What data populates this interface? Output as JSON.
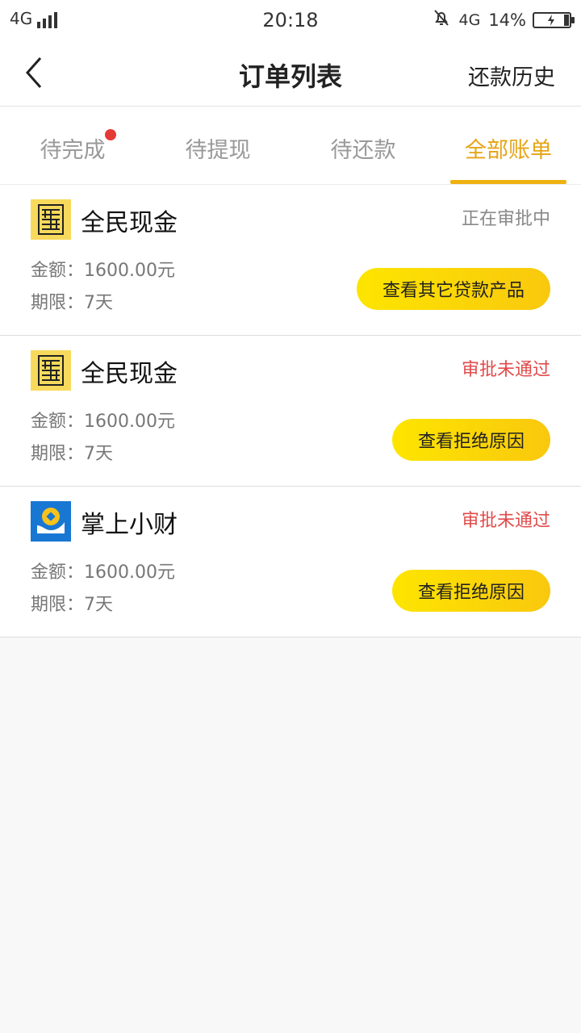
{
  "status_bar": {
    "network_left": "4G",
    "time": "20:18",
    "network_right": "4G",
    "battery_percent": "14%",
    "icons": [
      "signal-icon",
      "mute-icon",
      "battery-charging-icon"
    ]
  },
  "nav": {
    "title": "订单列表",
    "right_link": "还款历史",
    "back_icon": "chevron-left-icon"
  },
  "tabs": [
    {
      "label": "待完成",
      "badge": true
    },
    {
      "label": "待提现",
      "badge": false
    },
    {
      "label": "待还款",
      "badge": false
    },
    {
      "label": "全部账单",
      "badge": false,
      "active": true
    }
  ],
  "colors": {
    "accent": "#e6a414",
    "reject": "#e14b4b",
    "pending": "#888888",
    "button_start": "#fde500",
    "button_end": "#f9c80e"
  },
  "orders": [
    {
      "product": "全民现金",
      "logo": "quanmin-xianjin-logo",
      "status": "正在审批中",
      "status_type": "pending",
      "amount_label": "金额：",
      "amount": "1600.00元",
      "term_label": "期限：",
      "term": "7天",
      "action": "查看其它贷款产品"
    },
    {
      "product": "全民现金",
      "logo": "quanmin-xianjin-logo",
      "status": "审批未通过",
      "status_type": "rejected",
      "amount_label": "金额：",
      "amount": "1600.00元",
      "term_label": "期限：",
      "term": "7天",
      "action": "查看拒绝原因"
    },
    {
      "product": "掌上小财",
      "logo": "zhangshang-xiaocai-logo",
      "status": "审批未通过",
      "status_type": "rejected",
      "amount_label": "金额：",
      "amount": "1600.00元",
      "term_label": "期限：",
      "term": "7天",
      "action": "查看拒绝原因"
    }
  ]
}
